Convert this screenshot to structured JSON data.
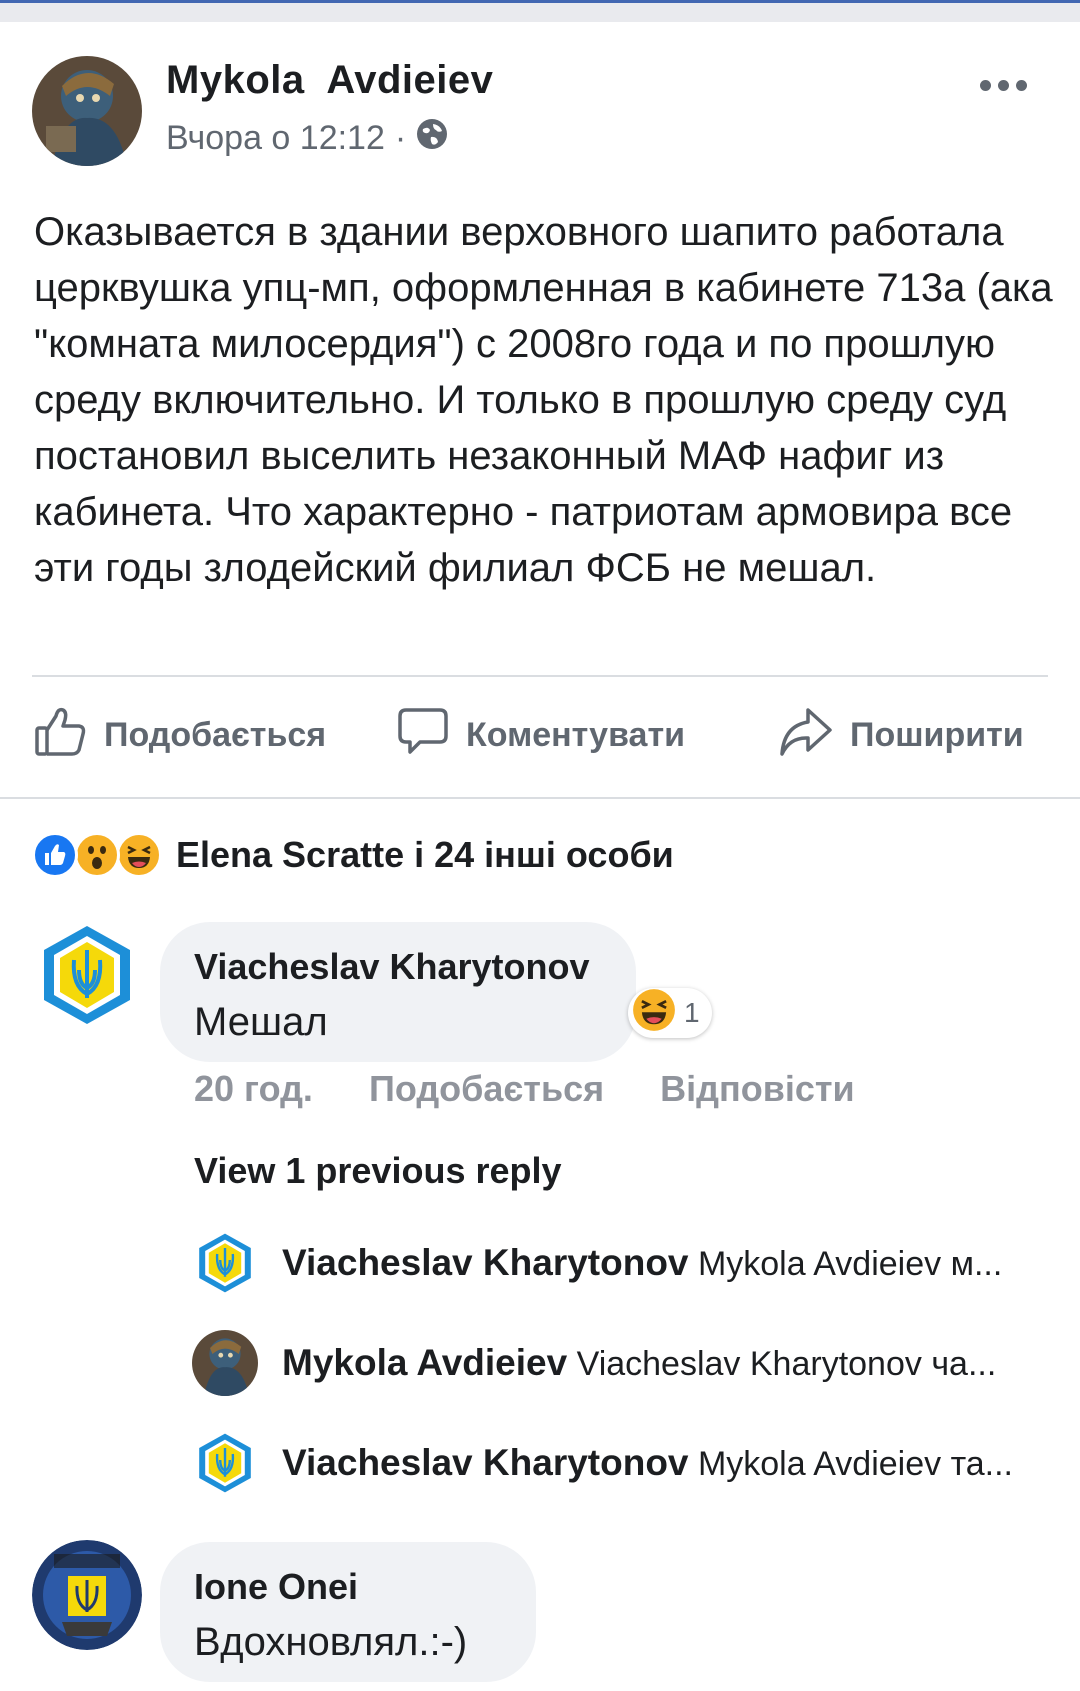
{
  "post": {
    "author": "Mykola  Avdieiev",
    "time": "Вчора о 12:12",
    "separator": "·",
    "text": "Оказывается в здании верховного шапито работала церквушка упц-мп, оформленная в кабинете 713а (ака \"комната милосердия\") с 2008го года и по прошлую среду включительно. И только в прошлую среду суд постановил выселить незаконный МАФ нафиг из кабинета. Что характерно - патриотам армовира все эти годы злодейский филиал ФСБ не мешал."
  },
  "actions": {
    "like": "Подобається",
    "comment": "Коментувати",
    "share": "Поширити"
  },
  "reactions": {
    "label": "Elena Scratte і 24 інші особи",
    "icons": [
      "like-reaction-icon",
      "wow-reaction-icon",
      "haha-reaction-icon"
    ]
  },
  "comments": [
    {
      "author": "Viacheslav Kharytonov",
      "text": "Мешал",
      "reaction_count": "1",
      "time": "20 год.",
      "like_label": "Подобається",
      "reply_label": "Відповісти",
      "view_previous": "View 1 previous reply",
      "replies": [
        {
          "author": "Viacheslav Kharytonov",
          "text": "Mykola  Avdieiev м..."
        },
        {
          "author": "Mykola  Avdieiev",
          "text": "Viacheslav Kharytonov ча..."
        },
        {
          "author": "Viacheslav Kharytonov",
          "text": "Mykola  Avdieiev та..."
        }
      ]
    },
    {
      "author": "Ione Onei",
      "text": "Вдохновлял.:-)"
    }
  ],
  "colors": {
    "accent": "#4267b2",
    "muted_text": "#606770",
    "bubble_bg": "#f0f2f5",
    "trident_blue": "#1d8fd8",
    "trident_yellow": "#f5d90a"
  }
}
